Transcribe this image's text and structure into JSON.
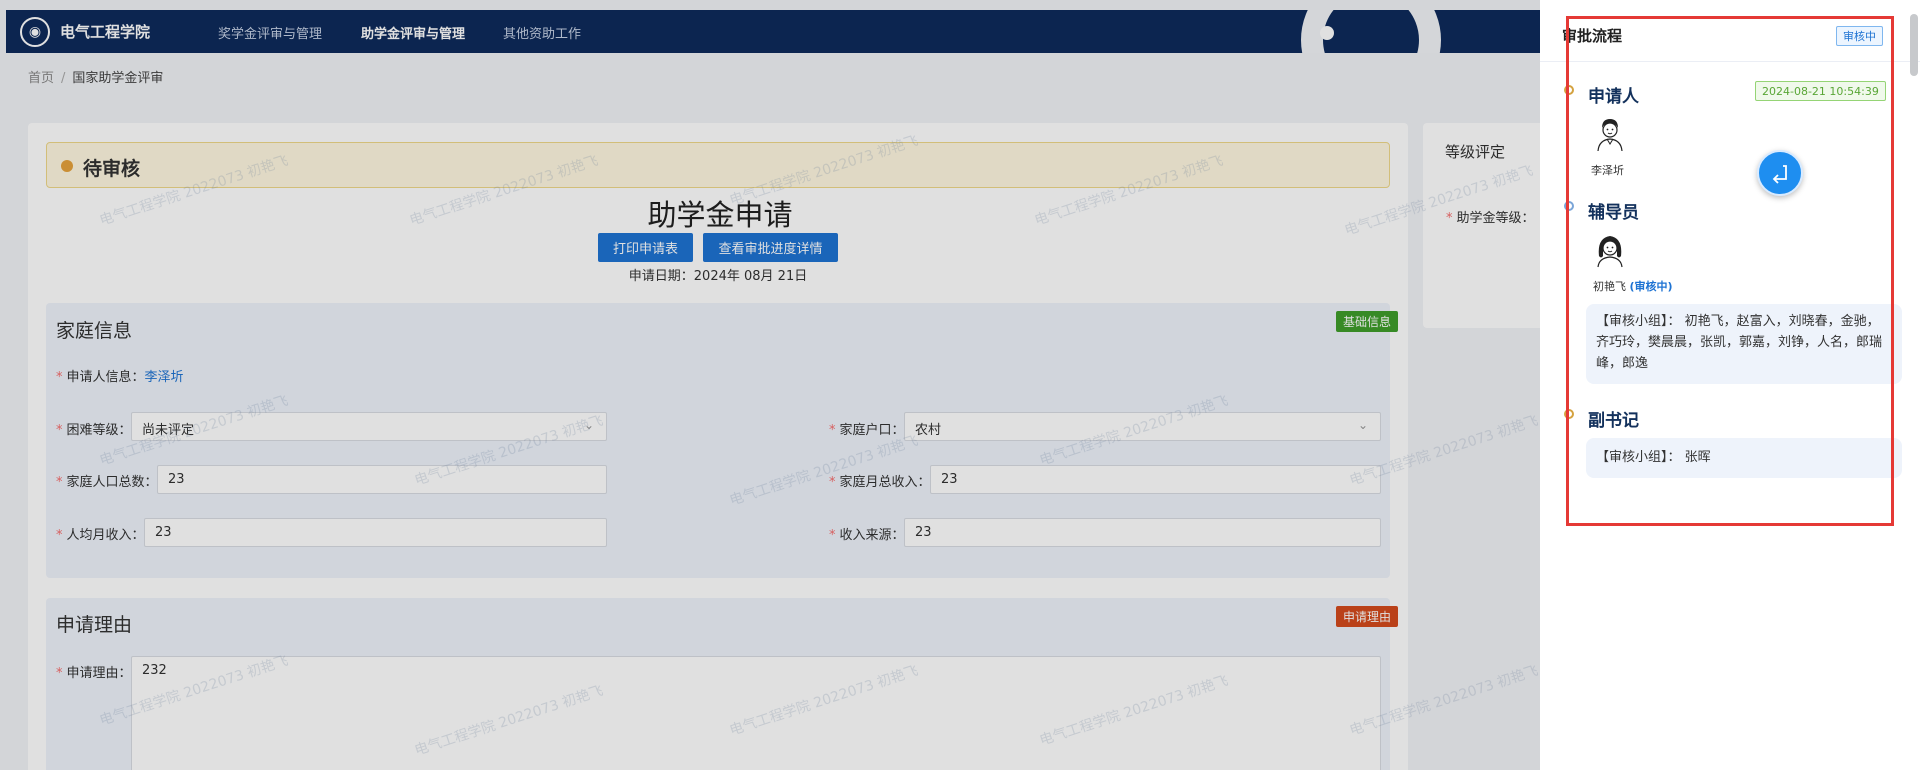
{
  "header": {
    "brand": "电气工程学院",
    "nav": [
      "奖学金评审与管理",
      "助学金评审与管理",
      "其他资助工作"
    ],
    "active_index": 1
  },
  "breadcrumb": {
    "home": "首页",
    "current": "国家助学金评审"
  },
  "status_banner": "待审核",
  "form": {
    "title": "助学金申请",
    "print_button": "打印申请表",
    "progress_button": "查看审批进度详情",
    "apply_date": "申请日期：2024年 08月 21日"
  },
  "family": {
    "title": "家庭信息",
    "tag": "基础信息",
    "applicant_label": "申请人信息：",
    "applicant_value": "李泽圻",
    "difficulty_label": "困难等级：",
    "difficulty_value": "尚未评定",
    "household_label": "家庭户口：",
    "household_value": "农村",
    "population_label": "家庭人口总数：",
    "population_value": "23",
    "monthly_income_label": "家庭月总收入：",
    "monthly_income_value": "23",
    "per_capita_label": "人均月收入：",
    "per_capita_value": "23",
    "income_source_label": "收入来源：",
    "income_source_value": "23"
  },
  "reason": {
    "title": "申请理由",
    "tag": "申请理由",
    "label": "申请理由：",
    "value": "232"
  },
  "rating": {
    "title": "等级评定",
    "level_label": "助学金等级："
  },
  "watermark": "电气工程学院 2022073 初艳飞",
  "drawer": {
    "title": "审批流程",
    "status_badge": "审核中",
    "steps": [
      {
        "title": "申请人",
        "time": "2024-08-21 10:54:39",
        "person": "李泽圻"
      },
      {
        "title": "辅导员",
        "person": "初艳飞",
        "person_status": "(审核中)",
        "group": "【审核小组】： 初艳飞，赵富入，刘晓春，金驰，齐巧玲，樊晨晨，张凯，郭嘉，刘铮，人名，郎瑞峰，郎逸"
      },
      {
        "title": "副书记",
        "group": "【审核小组】： 张晖"
      }
    ]
  },
  "colors": {
    "nav_bg": "#0e2b5c",
    "primary": "#1e73d3",
    "tag_green": "#3f9e2b",
    "tag_red": "#d44a1d",
    "highlight_red": "#e53935"
  }
}
